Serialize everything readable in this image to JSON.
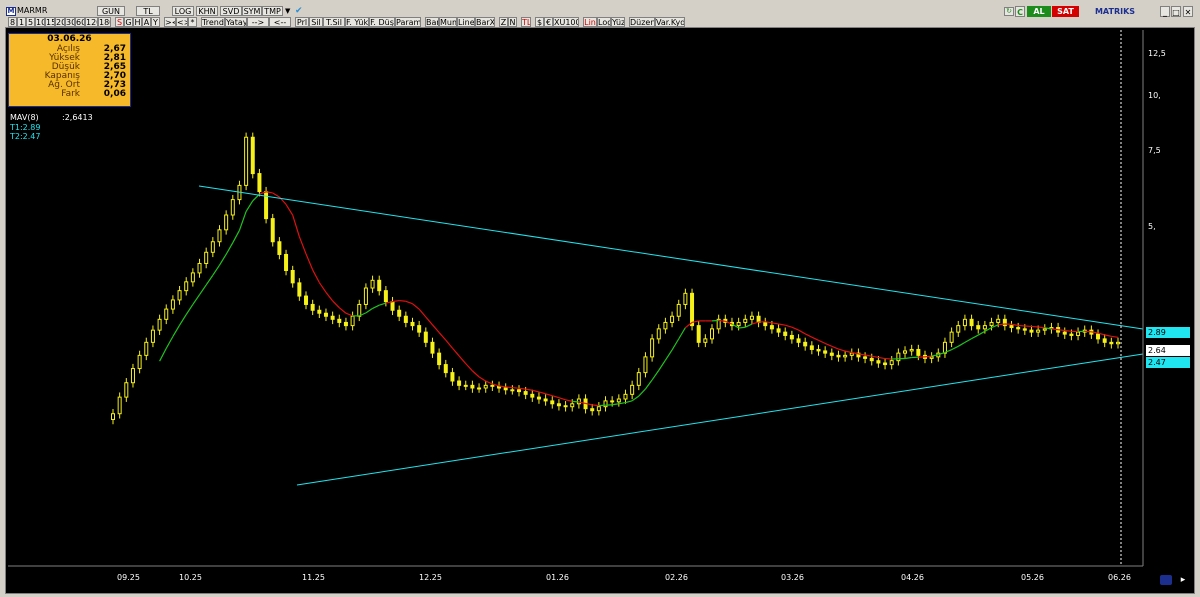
{
  "toolbar": {
    "row1_left": [
      {
        "label": "MARMR",
        "icon": "m-logo-icon"
      },
      {
        "label": "GUN"
      },
      {
        "label": "TL"
      },
      {
        "label": "LOG"
      },
      {
        "label": "KHN"
      },
      {
        "label": "SVD"
      },
      {
        "label": "SYM"
      },
      {
        "label": "TMP"
      }
    ],
    "row1_right": {
      "brand": "MATRIKS",
      "buy": "AL",
      "sell": "SAT",
      "c": "C",
      "brand_colors": {
        "buy": "#1c8c1c",
        "sell": "#d40000"
      }
    },
    "row2": [
      "8",
      "1",
      "5",
      "10",
      "15",
      "20",
      "30",
      "60",
      "120",
      "180",
      "S",
      "G",
      "H",
      "A",
      "Y",
      "><",
      "<>",
      "*",
      "Trend",
      "Yatay",
      "-->",
      "<--",
      "Prl",
      "Sil",
      "T.Sil",
      "F. Yük",
      "F. Düş",
      "Param",
      "Bar",
      "Mum",
      "Line",
      "BarX",
      "Z",
      "N",
      "TL",
      "$",
      "€",
      "XU100",
      "Lin",
      "Log",
      "Yüz",
      "Düzen",
      "Var.Kyd"
    ]
  },
  "info": {
    "date": "03.06.26",
    "rows": [
      {
        "label": "Açılış",
        "value": "2,67"
      },
      {
        "label": "Yüksek",
        "value": "2,81"
      },
      {
        "label": "Düşük",
        "value": "2,65"
      },
      {
        "label": "Kapanış",
        "value": "2,70"
      },
      {
        "label": "Ağ. Ort",
        "value": "2,73"
      },
      {
        "label": "Fark",
        "value": "0,06"
      }
    ]
  },
  "overlay": {
    "mav_label": "MAV(8)",
    "mav_value": ":2,6413",
    "t1": "T1:2.89",
    "t2": "T2:2.47"
  },
  "y_axis": [
    "12,5",
    "10,",
    "7,5",
    "5,"
  ],
  "price_tags": [
    {
      "text": "2.89",
      "bg": "#1fe6f0",
      "fg": "#000000"
    },
    {
      "text": "2.64",
      "bg": "#ffffff",
      "fg": "#000000"
    },
    {
      "text": "2.47",
      "bg": "#1fe6f0",
      "fg": "#000000"
    }
  ],
  "x_axis": [
    "09.25",
    "10.25",
    "11.25",
    "12.25",
    "01.26",
    "02.26",
    "03.26",
    "04.26",
    "05.26",
    "06.26"
  ],
  "chart_data": {
    "type": "candlestick",
    "symbol": "MARMR",
    "period": "GUN",
    "y_scale": "log",
    "y_ticks": [
      12.5,
      10,
      7.5,
      5
    ],
    "x_ticks": [
      "09.25",
      "10.25",
      "11.25",
      "12.25",
      "01.26",
      "02.26",
      "03.26",
      "04.26",
      "05.26",
      "06.26"
    ],
    "last_candle": {
      "date": "03.06.26",
      "open": 2.67,
      "high": 2.81,
      "low": 2.65,
      "close": 2.7,
      "avg": 2.73,
      "change": 0.06
    },
    "moving_average": {
      "name": "MAV(8)",
      "value": 2.6413,
      "colors": [
        "#1fc41f",
        "#e01010"
      ]
    },
    "trendlines": [
      {
        "name": "T1",
        "value": 2.89,
        "color": "#1fe6f0"
      },
      {
        "name": "T2",
        "value": 2.47,
        "color": "#1fe6f0"
      }
    ],
    "candle_color": "#f5f018",
    "closes": [
      1.85,
      2.02,
      2.18,
      2.35,
      2.52,
      2.7,
      2.88,
      3.05,
      3.22,
      3.38,
      3.55,
      3.72,
      3.9,
      4.1,
      4.35,
      4.6,
      4.9,
      5.3,
      5.75,
      6.2,
      8.0,
      6.6,
      6.0,
      5.2,
      4.6,
      4.3,
      3.95,
      3.7,
      3.45,
      3.3,
      3.2,
      3.15,
      3.1,
      3.05,
      3.0,
      2.95,
      3.1,
      3.3,
      3.6,
      3.75,
      3.55,
      3.35,
      3.2,
      3.1,
      3.0,
      2.95,
      2.85,
      2.7,
      2.55,
      2.4,
      2.3,
      2.2,
      2.15,
      2.15,
      2.12,
      2.12,
      2.15,
      2.14,
      2.12,
      2.1,
      2.1,
      2.08,
      2.05,
      2.02,
      2.0,
      1.98,
      1.95,
      1.93,
      1.92,
      1.95,
      2.0,
      1.9,
      1.88,
      1.92,
      1.98,
      1.97,
      2.0,
      2.05,
      2.15,
      2.3,
      2.5,
      2.75,
      2.9,
      3.0,
      3.1,
      3.3,
      3.5,
      2.95,
      2.7,
      2.75,
      2.9,
      3.05,
      3.0,
      2.95,
      3.0,
      3.05,
      3.1,
      3.0,
      2.95,
      2.9,
      2.85,
      2.8,
      2.75,
      2.7,
      2.65,
      2.6,
      2.58,
      2.55,
      2.52,
      2.5,
      2.52,
      2.55,
      2.5,
      2.48,
      2.45,
      2.42,
      2.4,
      2.45,
      2.55,
      2.58,
      2.6,
      2.52,
      2.48,
      2.5,
      2.55,
      2.7,
      2.85,
      2.95,
      3.05,
      2.95,
      2.9,
      2.95,
      3.0,
      3.05,
      2.95,
      2.92,
      2.9,
      2.88,
      2.85,
      2.88,
      2.9,
      2.92,
      2.85,
      2.82,
      2.8,
      2.85,
      2.88,
      2.82,
      2.75,
      2.7,
      2.68,
      2.7
    ]
  }
}
